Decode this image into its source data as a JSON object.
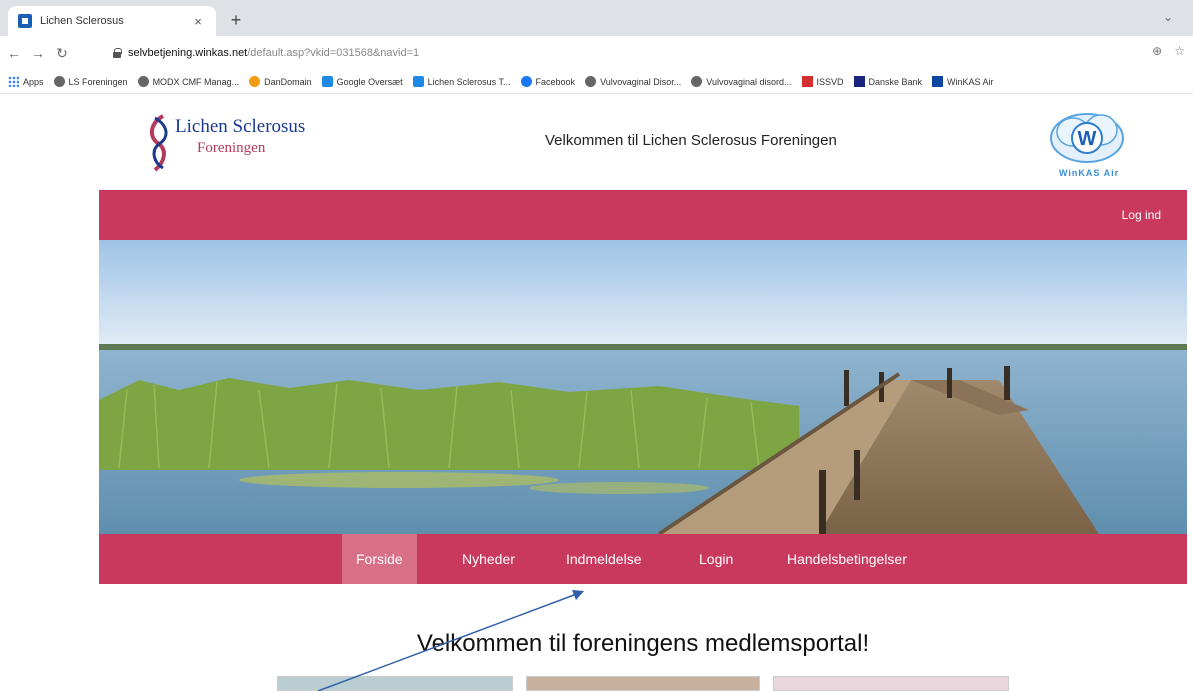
{
  "browser": {
    "tab_title": "Lichen Sclerosus",
    "tab_close": "×",
    "new_tab": "+",
    "window_ctrl": "⌄",
    "url_host": "selvbetjening.winkas.net",
    "url_path": "/default.asp?vkid=031568&navid=1",
    "bookmarks": [
      {
        "label": "Apps",
        "icon": "apps-grid-icon"
      },
      {
        "label": "LS Foreningen",
        "icon": "globe-icon"
      },
      {
        "label": "MODX CMF Manag...",
        "icon": "globe-icon"
      },
      {
        "label": "DanDomain",
        "icon": "dandomain-icon"
      },
      {
        "label": "Google Oversæt",
        "icon": "translate-icon"
      },
      {
        "label": "Lichen Sclerosus T...",
        "icon": "site-icon"
      },
      {
        "label": "Facebook",
        "icon": "facebook-icon"
      },
      {
        "label": "Vulvovaginal Disor...",
        "icon": "globe-icon"
      },
      {
        "label": "Vulvovaginal disord...",
        "icon": "globe-icon"
      },
      {
        "label": "ISSVD",
        "icon": "issvd-icon"
      },
      {
        "label": "Danske Bank",
        "icon": "bank-icon"
      },
      {
        "label": "WinKAS Air",
        "icon": "winkas-icon"
      }
    ]
  },
  "site": {
    "logo_line1": "Lichen Sclerosus",
    "logo_line2": "Foreningen",
    "header_title": "Velkommen til Lichen Sclerosus Foreningen",
    "winkas_logo_text": "WinKAS Air",
    "top_login": "Log ind",
    "nav": [
      "Forside",
      "Nyheder",
      "Indmeldelse",
      "Login",
      "Handelsbetingelser"
    ],
    "nav_active": "Forside",
    "welcome_heading": "Velkommen til foreningens medlemsportal!"
  },
  "colors": {
    "brand_pink": "#c9395e",
    "active_nav": "#d76f87",
    "annotation_arrow": "#2f5fa8"
  }
}
